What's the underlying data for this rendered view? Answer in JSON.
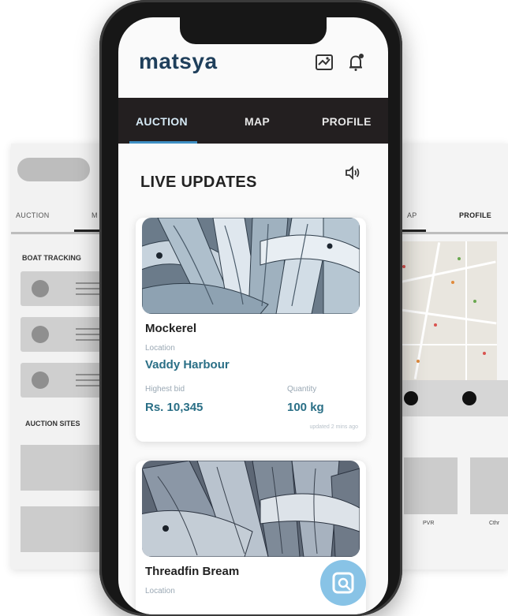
{
  "app": {
    "logo": "matsya"
  },
  "nav": {
    "tabs": [
      "AUCTION",
      "MAP",
      "PROFILE"
    ],
    "active_tab": "AUCTION"
  },
  "main": {
    "title": "LIVE UPDATES",
    "cards": [
      {
        "name": "Mockerel",
        "location_label": "Location",
        "location": "Vaddy Harbour",
        "bid_label": "Highest bid",
        "bid": "Rs. 10,345",
        "quantity_label": "Quantity",
        "quantity": "100 kg",
        "updated": "updated 2 mins ago"
      },
      {
        "name": "Threadfin Bream",
        "location_label": "Location"
      }
    ]
  },
  "wire_left": {
    "tabs": [
      "AUCTION",
      "M"
    ],
    "boat_tracking": "BOAT TRACKING",
    "auction_sites": "AUCTION SITES"
  },
  "wire_right": {
    "tabs": [
      "AP",
      "PROFILE"
    ],
    "labels": [
      "PVR",
      "Cthr"
    ]
  },
  "icons": {
    "map": "map-icon",
    "bell": "bell-icon",
    "speaker": "speaker-icon",
    "fab": "scan-icon"
  },
  "colors": {
    "nav_bg": "#231f20",
    "accent": "#3f8fc4",
    "value": "#2a6f86",
    "fab": "#88c3e6"
  }
}
